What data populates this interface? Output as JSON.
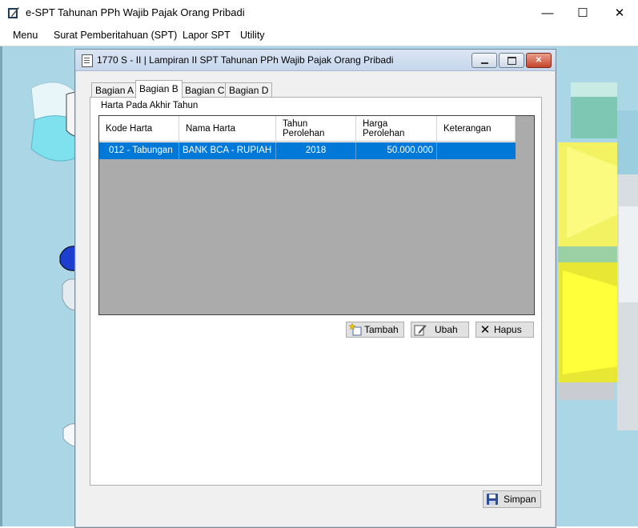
{
  "window": {
    "title": "e-SPT Tahunan PPh Wajib Pajak Orang Pribadi",
    "minimize": "—",
    "maximize": "☐",
    "close": "✕"
  },
  "menu": [
    "Menu",
    "Surat Pemberitahuan (SPT)",
    "Lapor SPT",
    "Utility"
  ],
  "child": {
    "title": "1770 S - II | Lampiran II SPT Tahunan PPh Wajib Pajak Orang Pribadi",
    "tabs": [
      "Bagian A",
      "Bagian B",
      "Bagian C",
      "Bagian D"
    ],
    "active_tab": "Bagian B",
    "section_label": "Harta Pada Akhir Tahun",
    "table": {
      "headers": [
        "Kode Harta",
        "Nama Harta",
        "Tahun\nPerolehan",
        "Harga\nPerolehan",
        "Keterangan"
      ],
      "rows": [
        [
          "012 - Tabungan",
          "BANK BCA - RUPIAH",
          "2018",
          "50.000.000",
          ""
        ]
      ]
    },
    "buttons": {
      "add": "Tambah",
      "edit": "Ubah",
      "delete": "Hapus",
      "save": "Simpan"
    }
  },
  "colors": {
    "selection": "#0078d7",
    "desktop": "#abd6e6",
    "grid_bg": "#ababab"
  }
}
